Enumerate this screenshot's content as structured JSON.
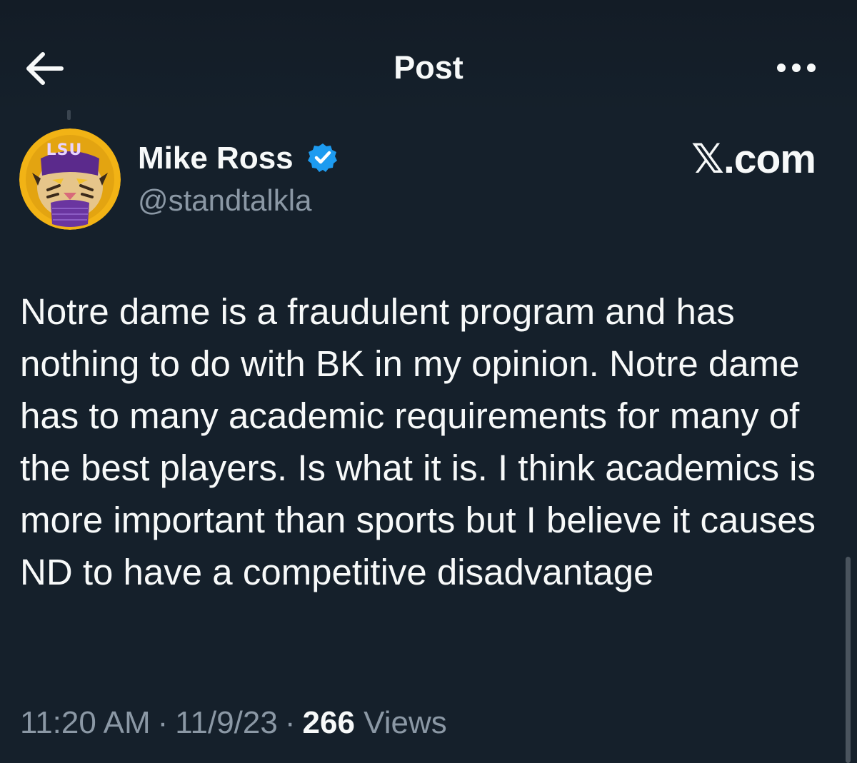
{
  "header": {
    "title": "Post",
    "back_icon": "arrow-left-icon",
    "more_icon": "more-horizontal-icon"
  },
  "author": {
    "display_name": "Mike Ross",
    "handle": "@standtalkla",
    "verified_icon": "verified-badge-icon",
    "verified_color": "#1d9bf0",
    "avatar_text": "LSU"
  },
  "watermark": "𝕏.com",
  "post": {
    "text": "Notre dame is a fraudulent program and has nothing to do with BK in my opinion. Notre dame has to many academic requirements for many of the best players. Is what it is. I think academics is more important than sports but I believe it causes ND to have a competitive disadvantage"
  },
  "meta": {
    "time": "11:20 AM",
    "separator": "·",
    "date": "11/9/23",
    "views_count": "266",
    "views_label": "Views"
  },
  "colors": {
    "background": "#15202b",
    "text_primary": "#f7f9f9",
    "text_secondary": "#8b98a5",
    "accent": "#1d9bf0"
  }
}
